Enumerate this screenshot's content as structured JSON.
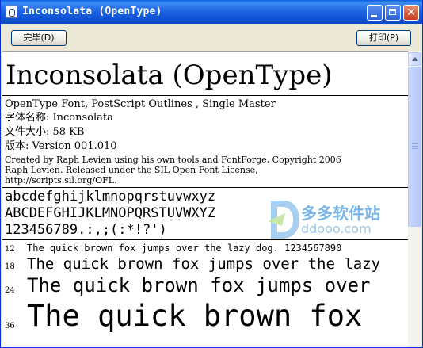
{
  "window": {
    "title": "Inconsolata (OpenType)",
    "icon": "font-file-icon"
  },
  "toolbar": {
    "done_label": "完毕(D)",
    "print_label": "打印(P)"
  },
  "content": {
    "font_name": "Inconsolata (OpenType)",
    "info": {
      "type_line": "OpenType Font, PostScript Outlines , Single Master",
      "typeface_line": "字体名称: Inconsolata",
      "filesize_line": "文件大小: 58 KB",
      "version_line": "版本: Version 001.010",
      "copyright_1": "Created by Raph Levien using his own tools and FontForge. Copyright 2006",
      "copyright_2": "Raph Levien. Released under the SIL Open Font License,",
      "copyright_3": "http://scripts.sil.org/OFL."
    },
    "charset": {
      "lower": "abcdefghijklmnopqrstuvwxyz",
      "upper": "ABCDEFGHIJKLMNOPQRSTUVWXYZ",
      "digits": "123456789.:,;(:*!?')"
    },
    "samples": [
      {
        "size": "12",
        "text": "The quick brown fox jumps over the lazy dog. 1234567890"
      },
      {
        "size": "18",
        "text": "The quick brown fox jumps over the lazy"
      },
      {
        "size": "24",
        "text": "The quick brown fox jumps over"
      },
      {
        "size": "36",
        "text": "The quick brown fox"
      }
    ]
  },
  "watermark": {
    "name": "多多软件站",
    "url": "ddooo.com"
  },
  "colors": {
    "titlebar": "#0F52D3",
    "accent": "#7BB5E9"
  }
}
